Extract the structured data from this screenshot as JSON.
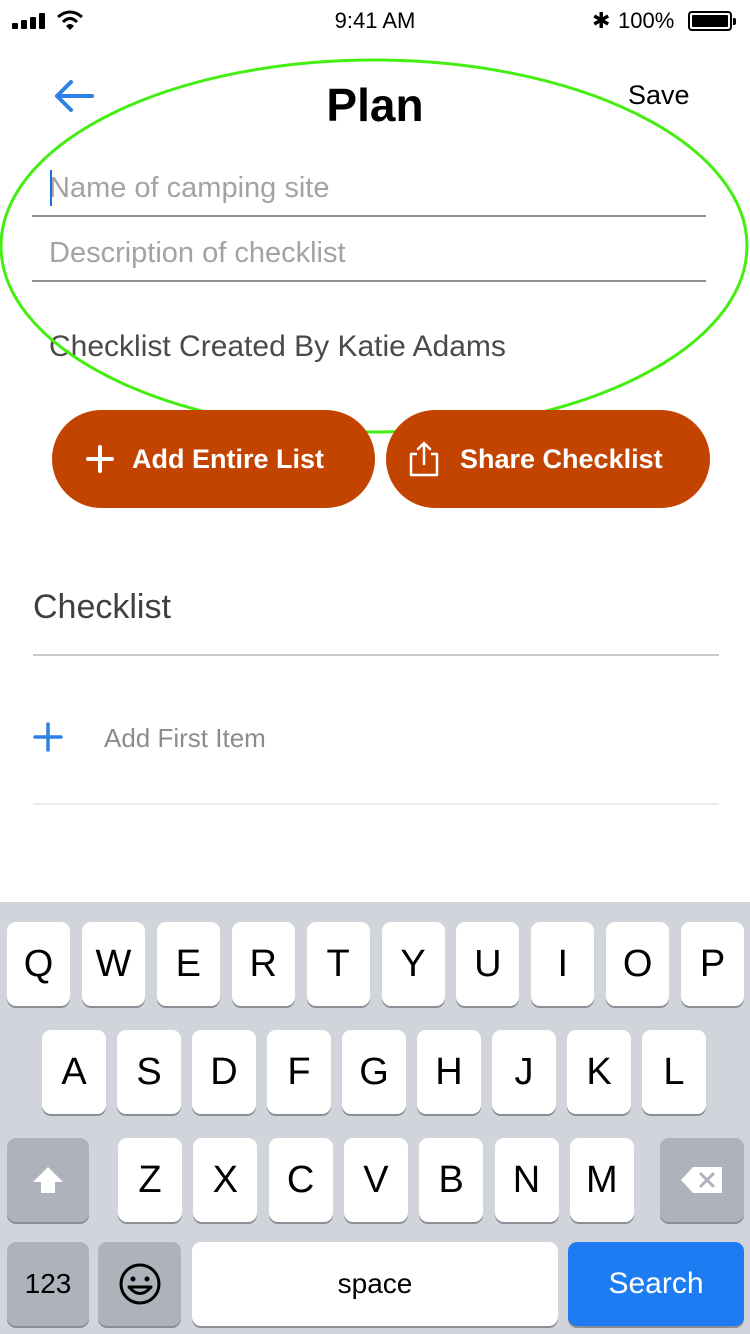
{
  "status_bar": {
    "time": "9:41 AM",
    "battery_percent": "100%"
  },
  "header": {
    "title": "Plan",
    "save_label": "Save"
  },
  "form": {
    "name_placeholder": "Name of camping site",
    "description_placeholder": "Description of checklist",
    "created_by": "Checklist Created By Katie Adams"
  },
  "actions": {
    "add_entire_list": "Add Entire List",
    "share_checklist": "Share Checklist"
  },
  "checklist": {
    "heading": "Checklist",
    "add_first_item": "Add First Item"
  },
  "keyboard": {
    "row1": [
      "Q",
      "W",
      "E",
      "R",
      "T",
      "Y",
      "U",
      "I",
      "O",
      "P"
    ],
    "row2": [
      "A",
      "S",
      "D",
      "F",
      "G",
      "H",
      "J",
      "K",
      "L"
    ],
    "row3": [
      "Z",
      "X",
      "C",
      "V",
      "B",
      "N",
      "M"
    ],
    "numbers_label": "123",
    "space_label": "space",
    "search_label": "Search"
  },
  "colors": {
    "accent_blue": "#1e6fd9",
    "button_orange": "#c24400",
    "annotation_green": "#44ee11",
    "search_key": "#1e7cf2"
  },
  "icons": [
    "signal-icon",
    "wifi-icon",
    "bluetooth-icon",
    "battery-icon",
    "back-arrow-icon",
    "plus-icon",
    "share-icon",
    "shift-icon",
    "backspace-icon",
    "emoji-icon"
  ]
}
